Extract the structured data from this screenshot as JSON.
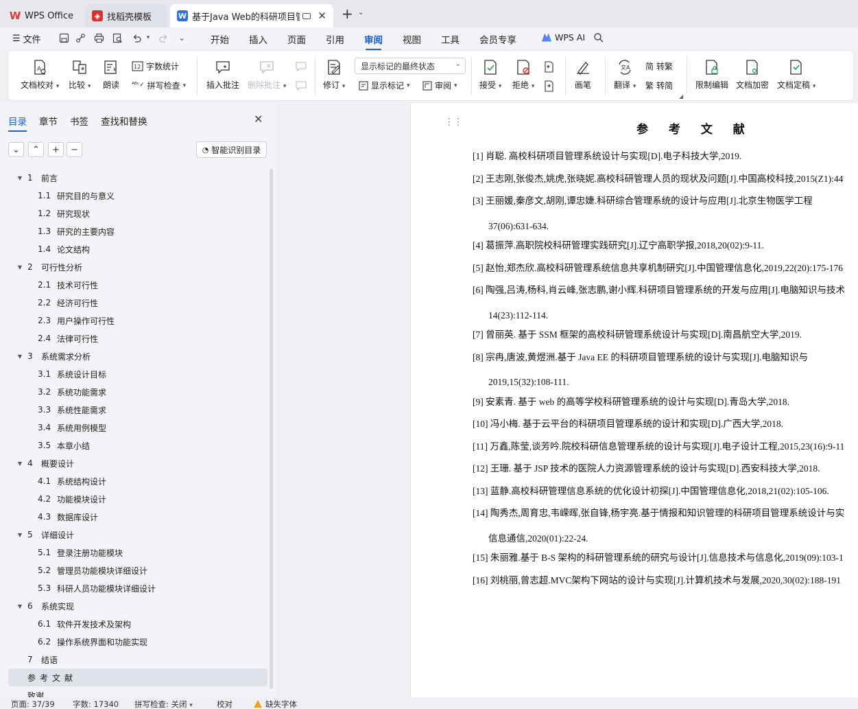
{
  "tabs": [
    {
      "label": "WPS Office"
    },
    {
      "label": "找稻壳模板"
    },
    {
      "label": "基于Java Web的科研项目管理"
    }
  ],
  "menu": {
    "file": "文件",
    "tabs": [
      "开始",
      "插入",
      "页面",
      "引用",
      "审阅",
      "视图",
      "工具",
      "会员专享"
    ],
    "active_tab": "审阅",
    "wps_ai": "WPS AI"
  },
  "ribbon": {
    "doc_check": "文档校对",
    "compare": "比较",
    "read_aloud": "朗读",
    "word_count": "字数统计",
    "spell_check": "拼写检查",
    "insert_comment": "插入批注",
    "delete_comment": "删除批注",
    "revise": "修订",
    "markup_select": "显示标记的最终状态",
    "show_markup": "显示标记",
    "review": "审阅",
    "accept": "接受",
    "reject": "拒绝",
    "pen": "画笔",
    "translate": "翻译",
    "to_traditional": "转繁",
    "to_simplified": "转简",
    "restrict_edit": "限制编辑",
    "encrypt": "文档加密",
    "finalize": "文档定稿"
  },
  "nav": {
    "tabs": [
      "目录",
      "章节",
      "书签",
      "查找和替换"
    ],
    "active": "目录",
    "smart_toc": "智能识别目录",
    "toc": [
      {
        "level": 1,
        "num": "1",
        "label": "前言"
      },
      {
        "level": 2,
        "num": "1.1",
        "label": "研究目的与意义"
      },
      {
        "level": 2,
        "num": "1.2",
        "label": "研究现状"
      },
      {
        "level": 2,
        "num": "1.3",
        "label": "研究的主要内容"
      },
      {
        "level": 2,
        "num": "1.4",
        "label": "论文结构"
      },
      {
        "level": 1,
        "num": "2",
        "label": "可行性分析"
      },
      {
        "level": 2,
        "num": "2.1",
        "label": "技术可行性"
      },
      {
        "level": 2,
        "num": "2.2",
        "label": "经济可行性"
      },
      {
        "level": 2,
        "num": "2.3",
        "label": "用户操作可行性"
      },
      {
        "level": 2,
        "num": "2.4",
        "label": "法律可行性"
      },
      {
        "level": 1,
        "num": "3",
        "label": "系统需求分析"
      },
      {
        "level": 2,
        "num": "3.1",
        "label": "系统设计目标"
      },
      {
        "level": 2,
        "num": "3.2",
        "label": "系统功能需求"
      },
      {
        "level": 2,
        "num": "3.3",
        "label": "系统性能需求"
      },
      {
        "level": 2,
        "num": "3.4",
        "label": "系统用例模型"
      },
      {
        "level": 2,
        "num": "3.5",
        "label": "本章小结"
      },
      {
        "level": 1,
        "num": "4",
        "label": "概要设计"
      },
      {
        "level": 2,
        "num": "4.1",
        "label": "系统结构设计"
      },
      {
        "level": 2,
        "num": "4.2",
        "label": "功能模块设计"
      },
      {
        "level": 2,
        "num": "4.3",
        "label": "数据库设计"
      },
      {
        "level": 1,
        "num": "5",
        "label": "详细设计"
      },
      {
        "level": 2,
        "num": "5.1",
        "label": "登录注册功能模块"
      },
      {
        "level": 2,
        "num": "5.2",
        "label": "管理员功能模块详细设计"
      },
      {
        "level": 2,
        "num": "5.3",
        "label": "科研人员功能模块详细设计"
      },
      {
        "level": 1,
        "num": "6",
        "label": "系统实现"
      },
      {
        "level": 2,
        "num": "6.1",
        "label": "软件开发技术及架构"
      },
      {
        "level": 2,
        "num": "6.2",
        "label": "操作系统界面和功能实现"
      },
      {
        "level": 1,
        "num": "7",
        "label": "结语",
        "noToggle": true
      },
      {
        "level": 1,
        "num": "",
        "label": "参考文献",
        "noToggle": true,
        "selected": true
      },
      {
        "level": 1,
        "num": "",
        "label": "致谢",
        "noToggle": true
      }
    ]
  },
  "document": {
    "title": "参 考 文 献",
    "references": [
      {
        "n": "[1]",
        "t": "肖聪.  高校科研项目管理系统设计与实现[D].电子科技大学,2019."
      },
      {
        "n": "[2]",
        "t": "王志刚,张俊杰,姚虎,张晓妮.高校科研管理人员的现状及问题[J].中国高校科技,2015(Z1):44"
      },
      {
        "n": "[3]",
        "t": "王丽媛,秦彦文,胡刚,谭忠婕.科研综合管理系统的设计与应用[J].北京生物医学工程",
        "t2": "37(06):631-634."
      },
      {
        "n": "[4]",
        "t": "葛振萍.高职院校科研管理实践研究[J].辽宁高职学报,2018,20(02):9-11."
      },
      {
        "n": "[5]",
        "t": "赵怡,郑杰欣.高校科研管理系统信息共享机制研究[J].中国管理信息化,2019,22(20):175-176"
      },
      {
        "n": "[6]",
        "t": "陶强,吕涛,杨科,肖云峰,张志鹏,谢小辉.科研项目管理系统的开发与应用[J].电脑知识与技术",
        "t2": "14(23):112-114."
      },
      {
        "n": "[7]",
        "t": "曾丽英.  基于 SSM 框架的高校科研管理系统设计与实现[D].南昌航空大学,2019."
      },
      {
        "n": "[8]",
        "t": "宗冉,唐波,黄煜洲.基于 Java EE 的科研项目管理系统的设计与实现[J].电脑知识与",
        "t2": "2019,15(32):108-111."
      },
      {
        "n": "[9]",
        "t": "安素青.  基于 web 的高等学校科研管理系统的设计与实现[D].青岛大学,2018."
      },
      {
        "n": "[10]",
        "t": "冯小梅.  基于云平台的科研项目管理系统的设计和实现[D].广西大学,2018."
      },
      {
        "n": "[11]",
        "t": "万鑫,陈莹,谈芳吟.院校科研信息管理系统的设计与实现[J].电子设计工程,2015,23(16):9-11"
      },
      {
        "n": "[12]",
        "t": "王珊.  基于 JSP 技术的医院人力资源管理系统的设计与实现[D].西安科技大学,2018."
      },
      {
        "n": "[13]",
        "t": "蓝静.高校科研管理信息系统的优化设计初探[J].中国管理信息化,2018,21(02):105-106."
      },
      {
        "n": "[14]",
        "t": "陶秀杰,周育忠,韦嵘晖,张自锋,杨宇亮.基于情报和知识管理的科研项目管理系统设计与实",
        "t2": "信息通信,2020(01):22-24."
      },
      {
        "n": "[15]",
        "t": "朱丽雅.基于 B-S 架构的科研管理系统的研究与设计[J].信息技术与信息化,2019(09):103-1"
      },
      {
        "n": "[16]",
        "t": "刘桃丽,曾志超.MVC架构下网站的设计与实现[J].计算机技术与发展,2020,30(02):188-191"
      }
    ]
  },
  "status": {
    "page": "页面: 37/39",
    "words": "字数: 17340",
    "spell": "拼写检查: 关闭",
    "proof": "校对",
    "missing_font": "缺失字体"
  },
  "colors": {
    "accent": "#1f5fd6",
    "warning": "#f0a020"
  }
}
